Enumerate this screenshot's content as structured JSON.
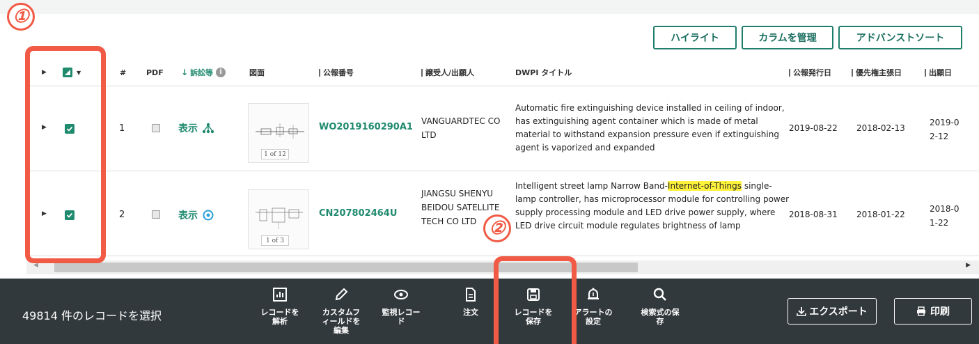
{
  "toolbar": {
    "highlight_label": "ハイライト",
    "manage_columns_label": "カラムを管理",
    "advanced_sort_label": "アドバンストソート"
  },
  "table": {
    "headers": {
      "index": "#",
      "pdf": "PDF",
      "litigation": "訴訟等",
      "drawing": "図面",
      "pub_number": "公報番号",
      "assignee": "譲受人/出願人",
      "dwpi_title": "DWPI タイトル",
      "pub_date": "公報発行日",
      "priority_date": "優先権主張日",
      "filing_date": "出願日"
    },
    "rows": [
      {
        "index": "1",
        "show_label": "表示",
        "thumb_page": "1 of 12",
        "pub_number": "WO2019160290A1",
        "assignee": "VANGUARDTEC CO LTD",
        "title_before": "Automatic fire extinguishing device installed in ceiling of indoor, has extinguishing agent container which is made of metal material to withstand expansion pressure even if extinguishing agent is vaporized and expanded",
        "title_highlight": "",
        "title_after": "",
        "pub_date": "2019-08-22",
        "priority_date": "2018-02-13",
        "filing_date": "2019-02-12"
      },
      {
        "index": "2",
        "show_label": "表示",
        "thumb_page": "1 of 3",
        "pub_number": "CN207802464U",
        "assignee": "JIANGSU SHENYU BEIDOU SATELLITE TECH CO LTD",
        "title_before": "Intelligent street lamp Narrow Band-",
        "title_highlight": "Internet-of-Things",
        "title_after": " single-lamp controller, has microprocessor module for controlling power supply processing module and LED drive power supply, where LED drive circuit module regulates brightness of lamp",
        "pub_date": "2018-08-31",
        "priority_date": "2018-01-22",
        "filing_date": "2018-01-22"
      }
    ]
  },
  "bottom_bar": {
    "selected_text": "49814 件のレコードを選択",
    "actions": [
      {
        "label": "レコードを解析",
        "icon": "chart-icon"
      },
      {
        "label": "カスタムフィールドを編集",
        "icon": "pencil-icon"
      },
      {
        "label": "監視レコード",
        "icon": "eye-icon"
      },
      {
        "label": "注文",
        "icon": "document-icon"
      },
      {
        "label": "レコードを保存",
        "icon": "save-icon"
      },
      {
        "label": "アラートの設定",
        "icon": "bell-icon"
      },
      {
        "label": "検索式の保存",
        "icon": "search-icon"
      }
    ],
    "export_label": "エクスポート",
    "print_label": "印刷"
  },
  "annotations": {
    "marker1": "①",
    "marker2": "②"
  },
  "colors": {
    "accent": "#1f8a6e",
    "highlight_frame": "#f15a44",
    "bottom_bar": "#32393c",
    "text_highlight": "#fff23a"
  }
}
